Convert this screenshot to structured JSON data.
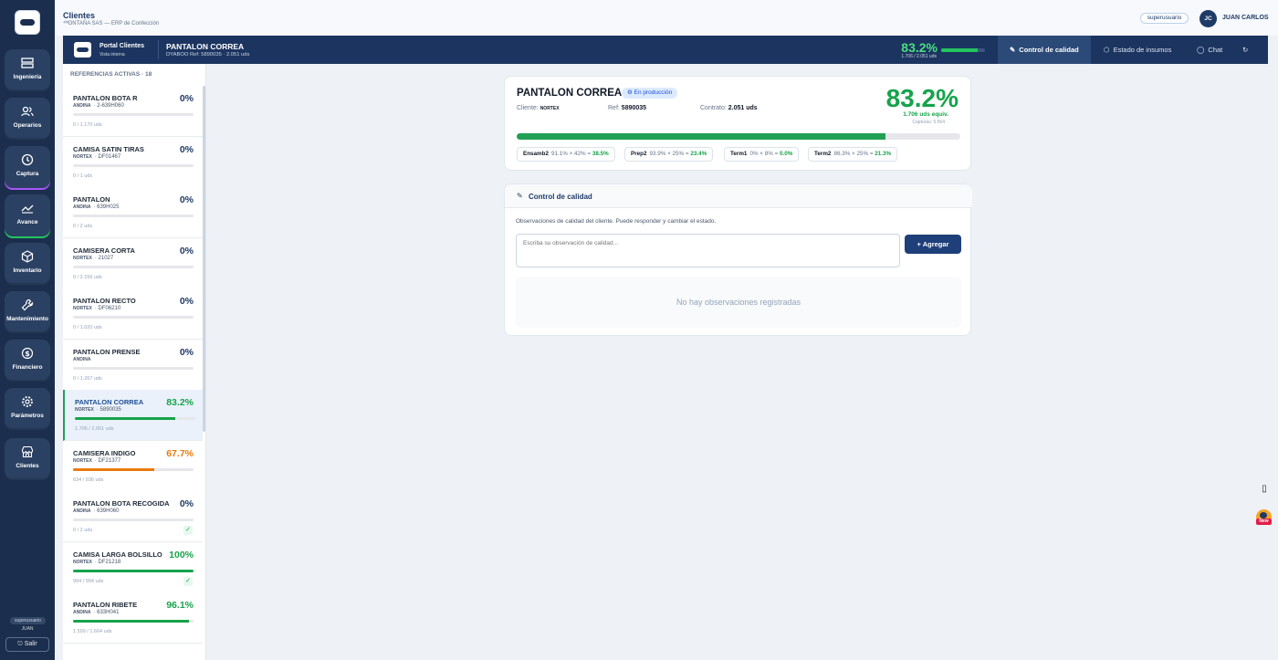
{
  "app": {
    "section_title": "Clientes",
    "subtitle": "⁴ᴹONTAÑA SAS — ERP de Confección",
    "role_pill": "superusuario",
    "user_initials": "JC",
    "user_name": "JUAN CARLOS"
  },
  "rail": {
    "items": [
      {
        "label": "Ingeniería",
        "icon": "ruler-icon"
      },
      {
        "label": "Operarios",
        "icon": "users-icon"
      },
      {
        "label": "Captura",
        "icon": "clock-icon"
      },
      {
        "label": "Avance",
        "icon": "chart-icon"
      },
      {
        "label": "Inventario",
        "icon": "box-icon"
      },
      {
        "label": "Mantenimiento",
        "icon": "wrench-icon"
      },
      {
        "label": "Financiero",
        "icon": "dollar-icon"
      },
      {
        "label": "Parámetros",
        "icon": "gear-icon"
      },
      {
        "label": "Clientes",
        "icon": "store-icon"
      }
    ],
    "role": "superusuario",
    "user": "JUAN",
    "logout": "⎋ Salir"
  },
  "portal": {
    "title": "Portal Clientes",
    "subtitle": "Vista interna",
    "product": "PANTALON CORREA",
    "product_meta": "DYABOO   Ref: 5890035 · 2.051 uds",
    "pct": "83.2%",
    "pct_value": 0.832,
    "counts": "1.706 / 2.051 uds",
    "tabs": [
      {
        "label": "Control de calidad",
        "icon": "pen-icon"
      },
      {
        "label": "Estado de insumos",
        "icon": "box-icon"
      },
      {
        "label": "Chat",
        "icon": "chat-icon"
      }
    ],
    "refresh_icon": "refresh-icon"
  },
  "list": {
    "header": "REFERENCIAS ACTIVAS · 18",
    "cards": [
      {
        "name": "PANTALON BOTA R",
        "client": "ANDINA",
        "ref": "2-639H060",
        "pct": "0%",
        "progress": 0,
        "qty": "0 / 1.170 uds",
        "color": "#16a34a",
        "pct_color": "#1e3a66",
        "check": false
      },
      {
        "name": "CAMISA SATIN TIRAS",
        "client": "NORTEX",
        "ref": "DF01467",
        "pct": "0%",
        "progress": 0,
        "qty": "0 / 1 uds",
        "color": "#16a34a",
        "pct_color": "#1e3a66",
        "check": false
      },
      {
        "name": "PANTALON",
        "client": "ANDINA",
        "ref": "639H025",
        "pct": "0%",
        "progress": 0,
        "qty": "0 / 2 uds",
        "color": "#16a34a",
        "pct_color": "#1e3a66",
        "check": false
      },
      {
        "name": "CAMISERA CORTA",
        "client": "NORTEX",
        "ref": "21027",
        "pct": "0%",
        "progress": 0,
        "qty": "0 / 2.156 uds",
        "color": "#16a34a",
        "pct_color": "#1e3a66",
        "check": false
      },
      {
        "name": "PANTALON RECTO",
        "client": "NORTEX",
        "ref": "DF06210",
        "pct": "0%",
        "progress": 0,
        "qty": "0 / 1.020 uds",
        "color": "#16a34a",
        "pct_color": "#1e3a66",
        "check": false
      },
      {
        "name": "PANTALON PRENSE",
        "client": "ANDINA",
        "ref": "",
        "pct": "0%",
        "progress": 0,
        "qty": "0 / 1.267 uds",
        "color": "#16a34a",
        "pct_color": "#1e3a66",
        "check": false
      },
      {
        "name": "PANTALON CORREA",
        "client": "NORTEX",
        "ref": "5890035",
        "pct": "83.2%",
        "progress": 0.832,
        "qty": "1.706 / 2.051 uds",
        "color": "#16a34a",
        "pct_color": "#16a34a",
        "check": false,
        "selected": true
      },
      {
        "name": "CAMISERA INDIGO",
        "client": "NORTEX",
        "ref": "DF21377",
        "pct": "67.7%",
        "progress": 0.677,
        "qty": "634 / 936 uds",
        "color": "#ea7a0c",
        "pct_color": "#ea7a0c",
        "check": false
      },
      {
        "name": "PANTALON BOTA RECOGIDA",
        "client": "ANDINA",
        "ref": "639H060",
        "pct": "0%",
        "progress": 0,
        "qty": "0 / 2 uds",
        "color": "#16a34a",
        "pct_color": "#1e3a66",
        "check": true
      },
      {
        "name": "CAMISA LARGA BOLSILLO",
        "client": "NORTEX",
        "ref": "DF21218",
        "pct": "100%",
        "progress": 1,
        "qty": "994 / 994 uds",
        "color": "#16a34a",
        "pct_color": "#16a34a",
        "check": true
      },
      {
        "name": "PANTALON RIBETE",
        "client": "ANDINA",
        "ref": "633H041",
        "pct": "96.1%",
        "progress": 0.961,
        "qty": "1.599 / 1.664 uds",
        "color": "#16a34a",
        "pct_color": "#16a34a",
        "check": false
      }
    ]
  },
  "summary": {
    "title": "PANTALON CORREA",
    "status": "⚙ En producción",
    "client_label": "Cliente:",
    "client": "NORTEX",
    "ref_label": "Ref:",
    "ref": "5890035",
    "contract_label": "Contrato:",
    "contract": "2.051 uds",
    "pct": "83.2%",
    "progress": 0.832,
    "equiv": "1.706 uds equiv.",
    "captures": "Capturas: 5.564",
    "chips": [
      {
        "name": "Ensamb2",
        "formula": "91.1% × 42% =",
        "result": "38.5%"
      },
      {
        "name": "Prep2",
        "formula": "93.9% × 25% =",
        "result": "23.4%"
      },
      {
        "name": "Term1",
        "formula": "0% × 8% =",
        "result": "0.0%"
      },
      {
        "name": "Term2",
        "formula": "86.3% × 25% =",
        "result": "21.3%"
      }
    ]
  },
  "quality": {
    "title": "Control de calidad",
    "icon": "pen-icon",
    "description": "Observaciones de calidad del cliente. Puede responder y cambiar el estado.",
    "placeholder": "Escriba su observación de calidad...",
    "add_label": "+ Agregar",
    "empty": "No hay observaciones registradas"
  },
  "floating": {
    "book_icon": "book-icon",
    "new_label": "New"
  }
}
